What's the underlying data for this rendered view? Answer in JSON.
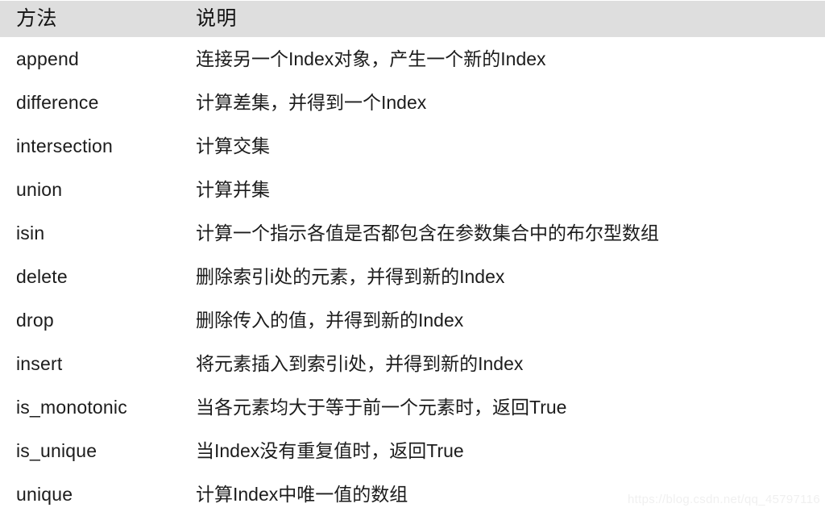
{
  "table": {
    "columns": [
      {
        "key": "method",
        "label": "方法"
      },
      {
        "key": "description",
        "label": "说明"
      }
    ],
    "rows": [
      {
        "method": "append",
        "description": "连接另一个Index对象，产生一个新的Index"
      },
      {
        "method": "difference",
        "description": "计算差集，并得到一个Index"
      },
      {
        "method": "intersection",
        "description": "计算交集"
      },
      {
        "method": "union",
        "description": "计算并集"
      },
      {
        "method": "isin",
        "description": "计算一个指示各值是否都包含在参数集合中的布尔型数组"
      },
      {
        "method": "delete",
        "description": "删除索引i处的元素，并得到新的Index"
      },
      {
        "method": "drop",
        "description": "删除传入的值，并得到新的Index"
      },
      {
        "method": "insert",
        "description": "将元素插入到索引i处，并得到新的Index"
      },
      {
        "method": "is_monotonic",
        "description": "当各元素均大于等于前一个元素时，返回True"
      },
      {
        "method": "is_unique",
        "description": "当Index没有重复值时，返回True"
      },
      {
        "method": "unique",
        "description": "计算Index中唯一值的数组"
      }
    ]
  },
  "watermark": {
    "text": "https://blog.csdn.net/qq_45797116"
  },
  "colors": {
    "header_background": "#dedede",
    "header_text": "#141414",
    "body_text": "#1c1c1c",
    "page_background": "#ffffff",
    "watermark_text": "#f0f0f0"
  }
}
